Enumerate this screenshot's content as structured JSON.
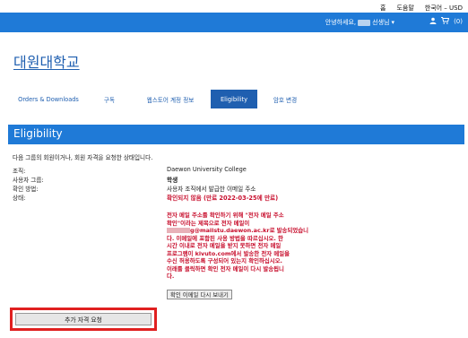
{
  "header": {
    "links": [
      "홈",
      "도움말",
      "한국어 – USD"
    ],
    "greeting_prefix": "안녕하세요,",
    "greeting_suffix": "선생님",
    "cart_count": "(0)"
  },
  "school": {
    "name": "대원대학교"
  },
  "tabs": [
    {
      "label": "Orders & Downloads",
      "active": false
    },
    {
      "label": "구독",
      "active": false
    },
    {
      "label": "웹스토어 계정 정보",
      "active": false
    },
    {
      "label": "Eligibility",
      "active": true
    },
    {
      "label": "암호 변경",
      "active": false
    }
  ],
  "page": {
    "heading": "Eligibility",
    "intro": "다음 그룹의 회원이거나, 회원 자격을 요청한 상태입니다."
  },
  "details": {
    "org_label": "조직:",
    "org_value": "Daewon University College",
    "group_label": "사용자 그룹:",
    "group_value": "학생",
    "method_label": "확인 방법:",
    "method_value": "사용자 조직에서 발급한 이메일 주소",
    "status_label": "상태:",
    "status_value": "확인되지 않음 (만료 2022-03-25에 만료)"
  },
  "warning": {
    "lines": [
      "전자 메일 주소를 확인하기 위해 \"전자 메일 주소",
      "확인\"이라는 제목으로 전자 메일이",
      "g@mailstu.daewon.ac.kr로 발송되었습니",
      "다. 이메일에 포함된 사용 방법을 따르십시오. 한",
      "시간 이내로 전자 메일을 받지 못하면 전자 메일",
      "프로그램이 kivuto.com에서 발송한 전자 메일을",
      "수신 허용하도록 구성되어 있는지 확인하십시오.",
      "이래를 클릭하면 확인 전자 메일이 다시 발송됩니",
      "다."
    ]
  },
  "buttons": {
    "resend": "확인 이메일 다시 보내기",
    "request": "추가 자격 요청"
  },
  "colors": {
    "brand_blue": "#1f7ad7",
    "tab_active": "#1f5fb0",
    "warning_red": "#c8102e",
    "highlight_red": "#e02020"
  }
}
